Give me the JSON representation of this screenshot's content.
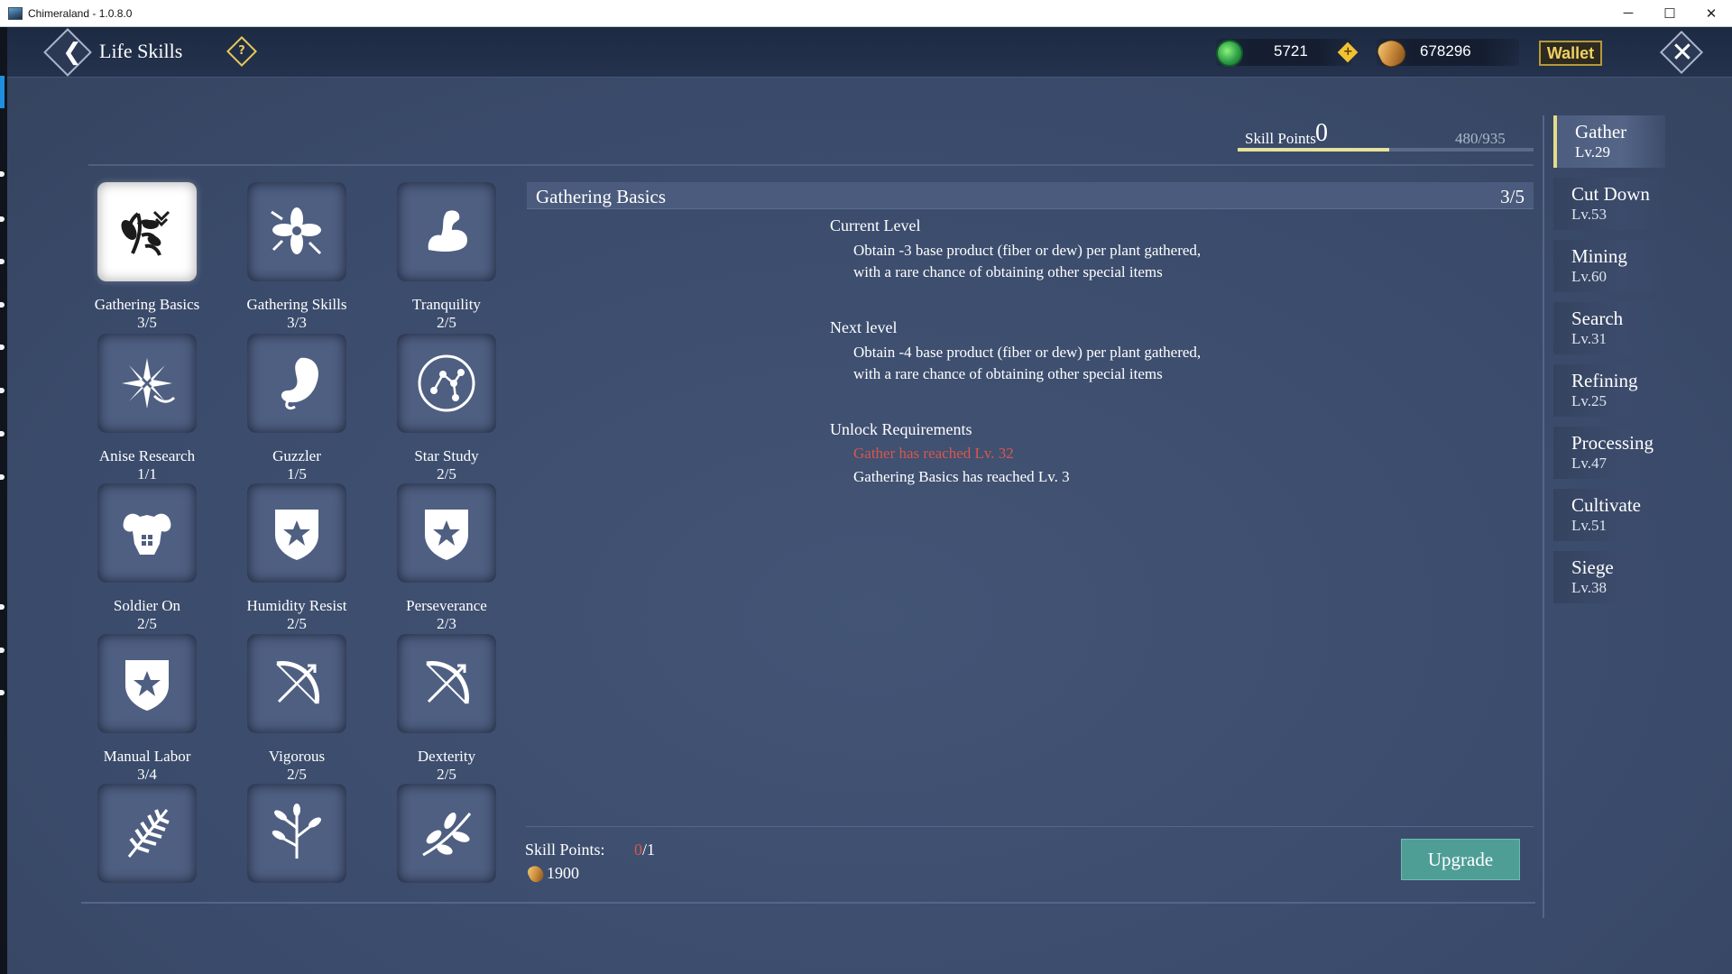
{
  "window": {
    "title": "Chimeraland - 1.0.8.0",
    "min": "─",
    "max": "☐",
    "close": "✕"
  },
  "header": {
    "title": "Life Skills",
    "help_icon": "?",
    "back_icon": "❮",
    "close_icon": "✕",
    "jade_value": "5721",
    "plus_label": "+",
    "seed_value": "678296",
    "wallet_label": "Wallet"
  },
  "skill_points": {
    "label": "Skill Points",
    "value": "0",
    "progress_text": "480/935",
    "progress_fraction": 0.513
  },
  "skills": [
    {
      "name": "Gathering Basics",
      "level": "3/5",
      "icon": "herb-icon",
      "selected": true
    },
    {
      "name": "Gathering Skills",
      "level": "3/3",
      "icon": "flower-icon"
    },
    {
      "name": "Tranquility",
      "level": "2/5",
      "icon": "arm-icon"
    },
    {
      "name": "Anise Research",
      "level": "1/1",
      "icon": "anise-icon"
    },
    {
      "name": "Guzzler",
      "level": "1/5",
      "icon": "stomach-icon"
    },
    {
      "name": "Star Study",
      "level": "2/5",
      "icon": "constellation-icon"
    },
    {
      "name": "Soldier On",
      "level": "2/5",
      "icon": "muscle-icon"
    },
    {
      "name": "Humidity Resist",
      "level": "2/5",
      "icon": "star-shield-icon"
    },
    {
      "name": "Perseverance",
      "level": "2/3",
      "icon": "star-shield-icon"
    },
    {
      "name": "Manual Labor",
      "level": "3/4",
      "icon": "star-shield-icon"
    },
    {
      "name": "Vigorous",
      "level": "2/5",
      "icon": "bow-icon"
    },
    {
      "name": "Dexterity",
      "level": "2/5",
      "icon": "bow-icon"
    },
    {
      "name": "",
      "level": "",
      "icon": "fern-icon"
    },
    {
      "name": "",
      "level": "",
      "icon": "sprig-icon"
    },
    {
      "name": "",
      "level": "",
      "icon": "branch-icon"
    }
  ],
  "detail": {
    "title": "Gathering Basics",
    "level": "3/5",
    "current_title": "Current Level",
    "current_body": "Obtain -3 base product (fiber or dew) per plant gathered, with a rare chance of obtaining other special items",
    "next_title": "Next level",
    "next_body": "Obtain -4 base product (fiber or dew) per plant gathered, with a rare chance of obtaining other special items",
    "unlock_title": "Unlock Requirements",
    "req_unmet": "Gather has reached Lv. 32",
    "req_met": "Gathering Basics has reached Lv. 3"
  },
  "footer": {
    "label": "Skill Points:",
    "current": "0",
    "required": "/1",
    "cost": "1900",
    "upgrade_label": "Upgrade"
  },
  "tabs": [
    {
      "name": "Gather",
      "level": "Lv.29",
      "active": true
    },
    {
      "name": "Cut Down",
      "level": "Lv.53"
    },
    {
      "name": "Mining",
      "level": "Lv.60"
    },
    {
      "name": "Search",
      "level": "Lv.31"
    },
    {
      "name": "Refining",
      "level": "Lv.25"
    },
    {
      "name": "Processing",
      "level": "Lv.47"
    },
    {
      "name": "Cultivate",
      "level": "Lv.51"
    },
    {
      "name": "Siege",
      "level": "Lv.38"
    }
  ],
  "colors": {
    "accent_gold": "#e2dc8c",
    "upgrade_teal": "#4e9e96",
    "requirement_red": "#d9574b",
    "panel_blue": "#3b4a6b"
  }
}
